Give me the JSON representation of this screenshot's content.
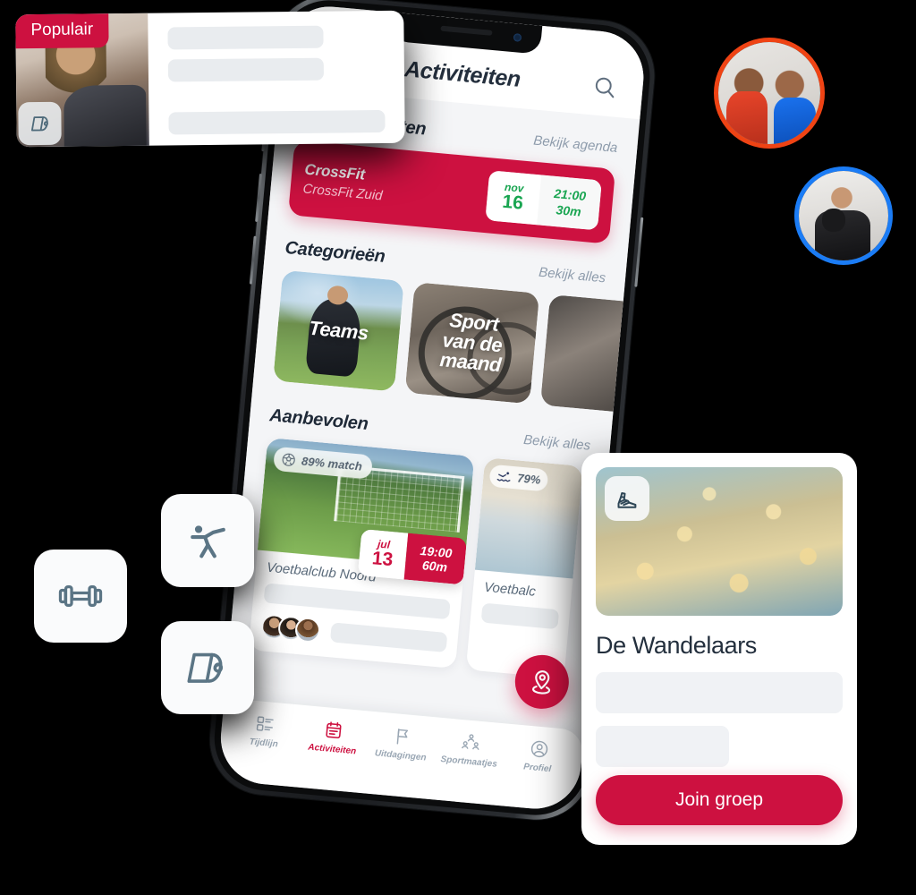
{
  "brand": {
    "red": "#CD1140",
    "green": "#19A551",
    "navy": "#1F2A38",
    "muted": "#8E9CAC",
    "slate_icon": "#5B7585",
    "orange_ring": "#EF4314",
    "blue_ring": "#1B7CF5"
  },
  "phone": {
    "app_title": "Activiteiten",
    "search_icon": "search-icon",
    "my_activities": {
      "title": "Mijn activiteiten",
      "link": "Bekijk agenda",
      "card": {
        "name": "CrossFit",
        "location": "CrossFit Zuid",
        "month": "nov",
        "day": "16",
        "time": "21:00",
        "duration": "30m"
      }
    },
    "categories": {
      "title": "Categorieën",
      "link": "Bekijk alles",
      "items": [
        {
          "label": "Teams",
          "image": "soccer-player-photo"
        },
        {
          "label": "Sport\nvan de\nmaand",
          "image": "bicycle-photo"
        },
        {
          "label": "",
          "image": "third-category-photo"
        }
      ]
    },
    "recommended": {
      "title": "Aanbevolen",
      "link": "Bekijk alles",
      "cards": [
        {
          "match": "89% match",
          "match_icon": "soccer-ball-icon",
          "name": "Voetbalclub Noord",
          "month": "jul",
          "day": "13",
          "time": "19:00",
          "duration": "60m",
          "image": "soccer-match-photo"
        },
        {
          "match": "79%",
          "match_icon": "swimming-icon",
          "name": "Voetbalc",
          "image": "pool-photo"
        }
      ]
    },
    "fab": {
      "icon": "location-pin-icon"
    },
    "bottom_nav": [
      {
        "label": "Tijdlijn",
        "icon": "timeline-icon",
        "active": false
      },
      {
        "label": "Activiteiten",
        "icon": "calendar-clipboard-icon",
        "active": true
      },
      {
        "label": "Uitdagingen",
        "icon": "flag-icon",
        "active": false
      },
      {
        "label": "Sportmaatjes",
        "icon": "people-group-icon",
        "active": false
      },
      {
        "label": "Profiel",
        "icon": "profile-icon",
        "active": false
      }
    ]
  },
  "popular_card": {
    "badge": "Populair",
    "icon": "yoga-mat-icon",
    "image": "gym-seniors-photo"
  },
  "group_card": {
    "title": "De Wandelaars",
    "icon": "hiking-boot-icon",
    "image": "blossom-photo",
    "join_label": "Join groep"
  },
  "floating_tiles": [
    {
      "name": "dumbbell-icon"
    },
    {
      "name": "gymnast-icon"
    },
    {
      "name": "yoga-mat-icon"
    }
  ],
  "avatar_circles": [
    {
      "name": "avatar-duo-flexing",
      "ring": "#EF4314"
    },
    {
      "name": "avatar-boxer",
      "ring": "#1B7CF5"
    }
  ]
}
